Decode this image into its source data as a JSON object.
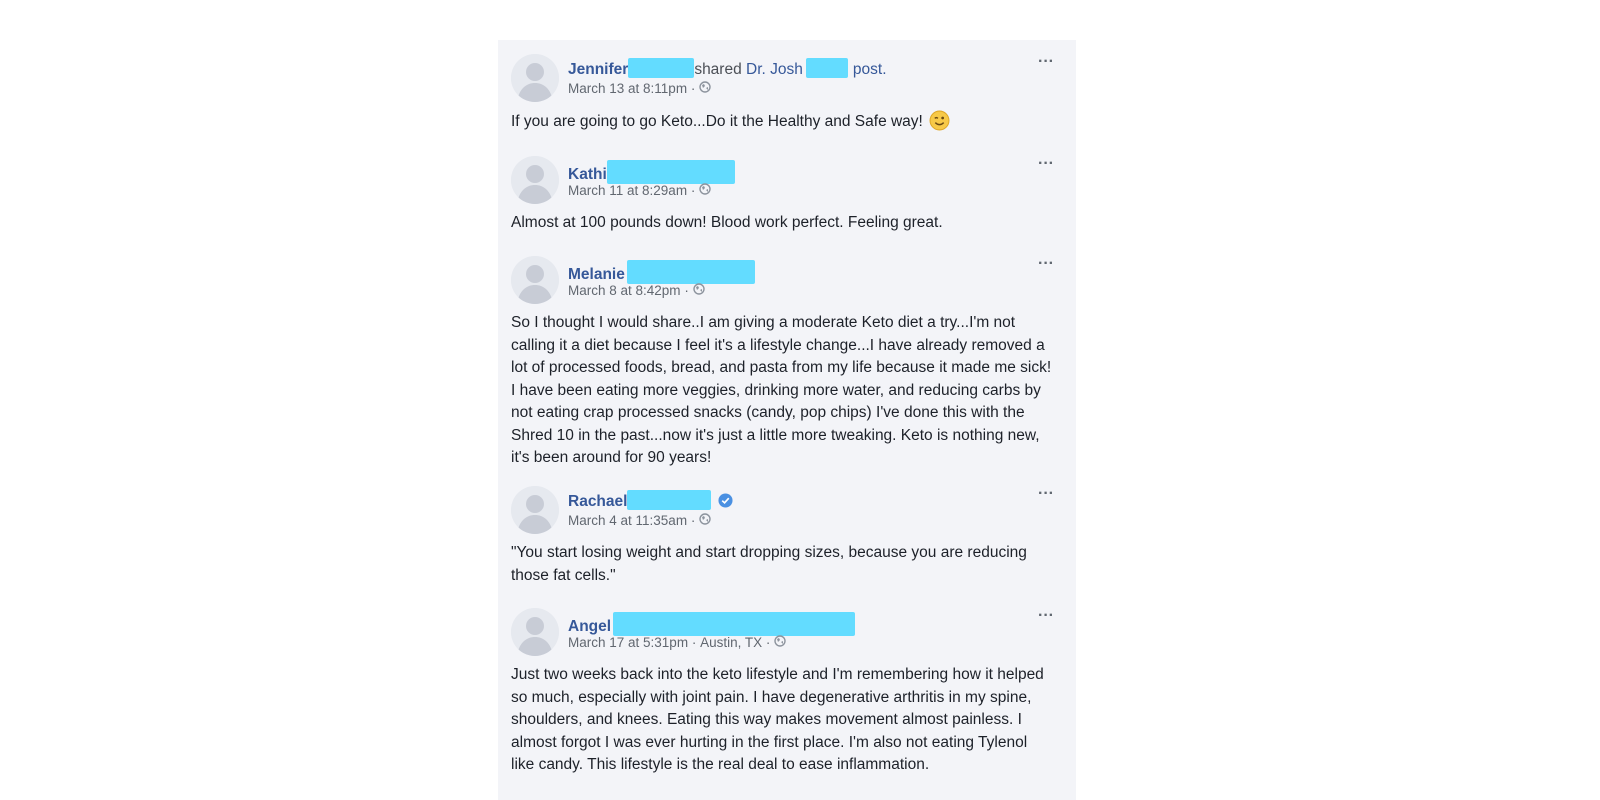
{
  "posts": [
    {
      "author": "Jennifer",
      "shared_text": "shared",
      "shared_page": "Dr. Josh",
      "post_link": "post.",
      "timestamp": "March 13 at 8:11pm",
      "location": "",
      "separator": "·",
      "body": "If you are going to go Keto...Do it the Healthy and Safe way!",
      "emoji": "winking-face",
      "verified": false
    },
    {
      "author": "Kathi",
      "timestamp": "March 11 at 8:29am",
      "separator": "·",
      "body": "Almost at 100 pounds down! Blood work perfect. Feeling great.",
      "verified": false
    },
    {
      "author": "Melanie",
      "timestamp": "March 8 at 8:42pm",
      "separator": "·",
      "body": "So I thought I would share..I am giving a moderate Keto diet a try...I'm not calling it a diet because I feel it's a lifestyle change...I have already removed a lot of processed foods, bread, and pasta from my life because it made me sick! I have been eating more veggies, drinking more water, and reducing carbs by not eating crap processed snacks (candy, pop chips) I've done this with the Shred 10 in the past...now it's just a little more tweaking. Keto is nothing new, it's been around for 90 years!",
      "verified": false
    },
    {
      "author": "Rachael",
      "timestamp": "March 4 at 11:35am",
      "separator": "·",
      "body": "\"You start losing weight and start dropping sizes, because you are reducing those fat cells.\"",
      "verified": true
    },
    {
      "author": "Angel",
      "timestamp": "March 17 at 5:31pm",
      "location": "Austin, TX",
      "separator": "·",
      "body": "Just two weeks back into the keto lifestyle and I'm remembering how it helped so much, especially with joint pain. I have degenerative arthritis in my spine, shoulders, and knees. Eating this way makes movement almost painless. I almost forgot I was ever hurting in the first place. I'm also not eating Tylenol like candy. This lifestyle is the real deal to ease inflammation.",
      "verified": false
    }
  ],
  "more_label": "···",
  "colors": {
    "feed_background": "#f3f4f8",
    "name": "#365899",
    "meta": "#616770",
    "redaction": "#63dcff",
    "verified": "#4a90e2"
  },
  "icons": {
    "avatar": "default-avatar-icon",
    "globe": "globe-icon",
    "more": "more-options-icon",
    "verified": "verified-badge-icon"
  }
}
